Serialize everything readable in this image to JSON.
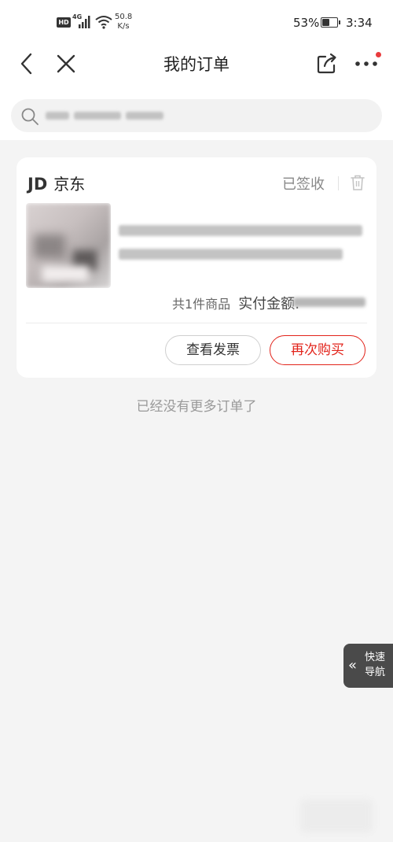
{
  "status_bar": {
    "hd_label": "HD",
    "network": "4G",
    "speed_value": "50.8",
    "speed_unit": "K/s",
    "battery_percent": "53%",
    "battery_level": 0.53,
    "time": "3:34"
  },
  "nav": {
    "title": "我的订单",
    "icons": [
      "back-arrow",
      "close-x",
      "share",
      "more-dots"
    ],
    "badge_color": "#e93b3d"
  },
  "search": {
    "icon": "search-icon"
  },
  "order": {
    "shop_prefix": "JD",
    "shop_name": "京东",
    "status": "已签收",
    "summary_count": "共1件商品",
    "summary_paid_label": "实付金额:",
    "actions": {
      "invoice": "查看发票",
      "rebuy": "再次购买"
    },
    "accent_color": "#e2231a"
  },
  "list_end_text": "已经没有更多订单了",
  "quick_nav": {
    "label": "快速导航",
    "icon": "double-chevron-left"
  }
}
